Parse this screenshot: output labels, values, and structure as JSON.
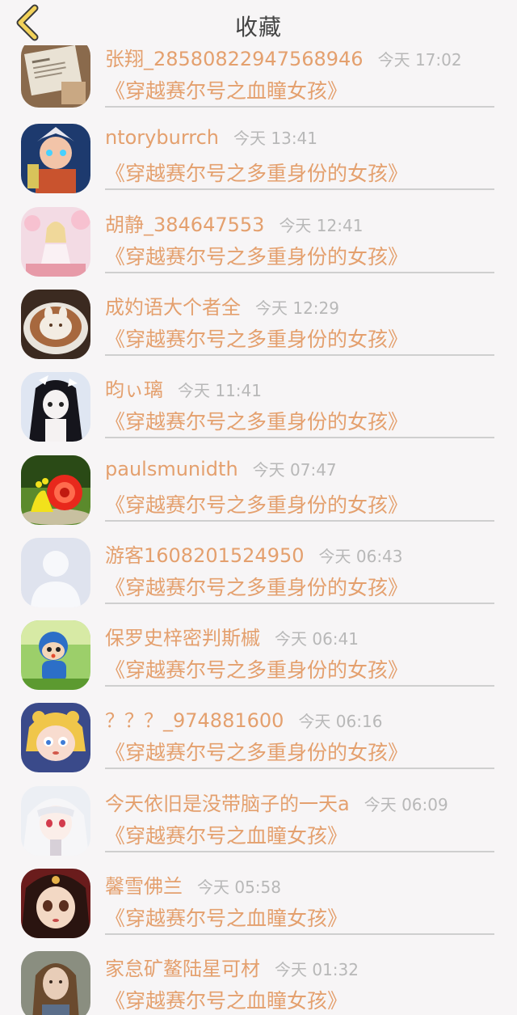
{
  "header": {
    "title": "收藏",
    "back_icon": "chevron-left-icon",
    "accent": "#f2d25a"
  },
  "favorites": [
    {
      "user": "张翔_285808229475689​46",
      "time": "今天 17:02",
      "book": "《穿越赛尔号之血瞳女孩》",
      "avatar": "newspaper-avatar"
    },
    {
      "user": "ntoryburrch",
      "time": "今天 13:41",
      "book": "《穿越赛尔号之多重身份的女孩》",
      "avatar": "warrior-avatar"
    },
    {
      "user": "胡静_384647553",
      "time": "今天 12:41",
      "book": "《穿越赛尔号之多重身份的女孩》",
      "avatar": "anime-girl-pink-avatar"
    },
    {
      "user": "成妁语大个者全",
      "time": "今天 12:29",
      "book": "《穿越赛尔号之多重身份的女孩》",
      "avatar": "latte-art-avatar"
    },
    {
      "user": "昀ぃ璃",
      "time": "今天 11:41",
      "book": "《穿越赛尔号之多重身份的女孩》",
      "avatar": "anime-girl-dark-avatar"
    },
    {
      "user": "paulsmunidth",
      "time": "今天 07:47",
      "book": "《穿越赛尔号之多重身份的女孩》",
      "avatar": "snail-avatar"
    },
    {
      "user": "游客1608201524950",
      "time": "今天 06:43",
      "book": "《穿越赛尔号之多重身份的女孩》",
      "avatar": "default-person-avatar"
    },
    {
      "user": "保罗史梓密判斯槭",
      "time": "今天 06:41",
      "book": "《穿越赛尔号之多重身份的女孩》",
      "avatar": "pocoyo-avatar"
    },
    {
      "user": "？？？_974881600",
      "time": "今天 06:16",
      "book": "《穿越赛尔号之多重身份的女孩》",
      "avatar": "cartoon-princess-avatar"
    },
    {
      "user": "今天依旧是没带脑子的一天a",
      "time": "今天 06:09",
      "book": "《穿越赛尔号之血瞳女孩》",
      "avatar": "white-hair-girl-avatar"
    },
    {
      "user": "馨雪佛兰",
      "time": "今天 05:58",
      "book": "《穿越赛尔号之血瞳女孩》",
      "avatar": "doll-girl-avatar"
    },
    {
      "user": "家怠矿鳌陆星可材",
      "time": "今天 01:32",
      "book": "《穿越赛尔号之血瞳女孩》",
      "avatar": "real-girl-avatar"
    }
  ]
}
